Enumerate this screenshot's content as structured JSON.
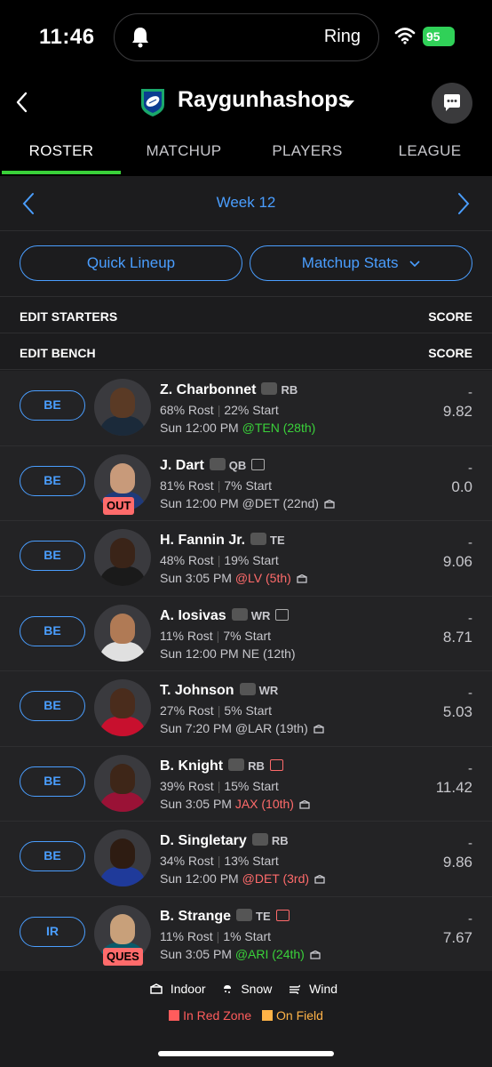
{
  "status_bar": {
    "time": "11:46",
    "island_label": "Ring",
    "battery": "95"
  },
  "header": {
    "team_name": "Raygunhashops"
  },
  "tabs": [
    {
      "label": "ROSTER",
      "active": true
    },
    {
      "label": "MATCHUP",
      "active": false
    },
    {
      "label": "PLAYERS",
      "active": false
    },
    {
      "label": "LEAGUE",
      "active": false
    }
  ],
  "week": {
    "label": "Week 12"
  },
  "buttons": {
    "quick_lineup": "Quick Lineup",
    "matchup_stats": "Matchup Stats"
  },
  "sections": {
    "starters": {
      "label": "EDIT STARTERS",
      "score_label": "SCORE"
    },
    "bench": {
      "label": "EDIT BENCH",
      "score_label": "SCORE"
    }
  },
  "players": [
    {
      "slot": "BE",
      "name": "Z. Charbonnet",
      "team_icon": "seahawks-icon",
      "pos": "RB",
      "news": false,
      "rost": "68% Rost",
      "start": "22% Start",
      "game_time": "Sun 12:00 PM",
      "opp": "@TEN (28th)",
      "opp_rating": "good",
      "indoor": false,
      "status": "",
      "dash": "-",
      "score": "9.82"
    },
    {
      "slot": "BE",
      "name": "J. Dart",
      "team_icon": "giants-icon",
      "pos": "QB",
      "news": true,
      "rost": "81% Rost",
      "start": "7% Start",
      "game_time": "Sun 12:00 PM",
      "opp": "@DET (22nd)",
      "opp_rating": "mid",
      "indoor": true,
      "status": "OUT",
      "dash": "-",
      "score": "0.0"
    },
    {
      "slot": "BE",
      "name": "H. Fannin Jr.",
      "team_icon": "browns-icon",
      "pos": "TE",
      "news": false,
      "rost": "48% Rost",
      "start": "19% Start",
      "game_time": "Sun 3:05 PM",
      "opp": "@LV (5th)",
      "opp_rating": "bad",
      "indoor": true,
      "status": "",
      "dash": "-",
      "score": "9.06"
    },
    {
      "slot": "BE",
      "name": "A. Iosivas",
      "team_icon": "bengals-icon",
      "pos": "WR",
      "news": true,
      "rost": "11% Rost",
      "start": "7% Start",
      "game_time": "Sun 12:00 PM",
      "opp": "NE (12th)",
      "opp_rating": "mid",
      "indoor": false,
      "status": "",
      "dash": "-",
      "score": "8.71"
    },
    {
      "slot": "BE",
      "name": "T. Johnson",
      "team_icon": "buccaneers-icon",
      "pos": "WR",
      "news": false,
      "rost": "27% Rost",
      "start": "5% Start",
      "game_time": "Sun 7:20 PM",
      "opp": "@LAR (19th)",
      "opp_rating": "mid",
      "indoor": true,
      "status": "",
      "dash": "-",
      "score": "5.03"
    },
    {
      "slot": "BE",
      "name": "B. Knight",
      "team_icon": "cardinals-icon",
      "pos": "RB",
      "news": true,
      "news_red": true,
      "rost": "39% Rost",
      "start": "15% Start",
      "game_time": "Sun 3:05 PM",
      "opp": "JAX (10th)",
      "opp_rating": "bad",
      "indoor": true,
      "status": "",
      "dash": "-",
      "score": "11.42"
    },
    {
      "slot": "BE",
      "name": "D. Singletary",
      "team_icon": "giants-icon",
      "pos": "RB",
      "news": false,
      "rost": "34% Rost",
      "start": "13% Start",
      "game_time": "Sun 12:00 PM",
      "opp": "@DET (3rd)",
      "opp_rating": "bad",
      "indoor": true,
      "status": "",
      "dash": "-",
      "score": "9.86"
    },
    {
      "slot": "IR",
      "name": "B. Strange",
      "team_icon": "jaguars-icon",
      "pos": "TE",
      "news": true,
      "news_red": true,
      "rost": "11% Rost",
      "start": "1% Start",
      "game_time": "Sun 3:05 PM",
      "opp": "@ARI (24th)",
      "opp_rating": "good",
      "indoor": true,
      "status": "QUES",
      "dash": "-",
      "score": "7.67"
    }
  ],
  "legend": {
    "indoor": "Indoor",
    "snow": "Snow",
    "wind": "Wind",
    "red_zone": "In Red Zone",
    "on_field": "On Field"
  },
  "colors": {
    "accent": "#4a9eff",
    "tab_active": "#3ad13a",
    "good": "#3ad13a",
    "bad": "#ff6b6b",
    "red_zone": "#ff5c5c",
    "on_field": "#ffb347"
  }
}
